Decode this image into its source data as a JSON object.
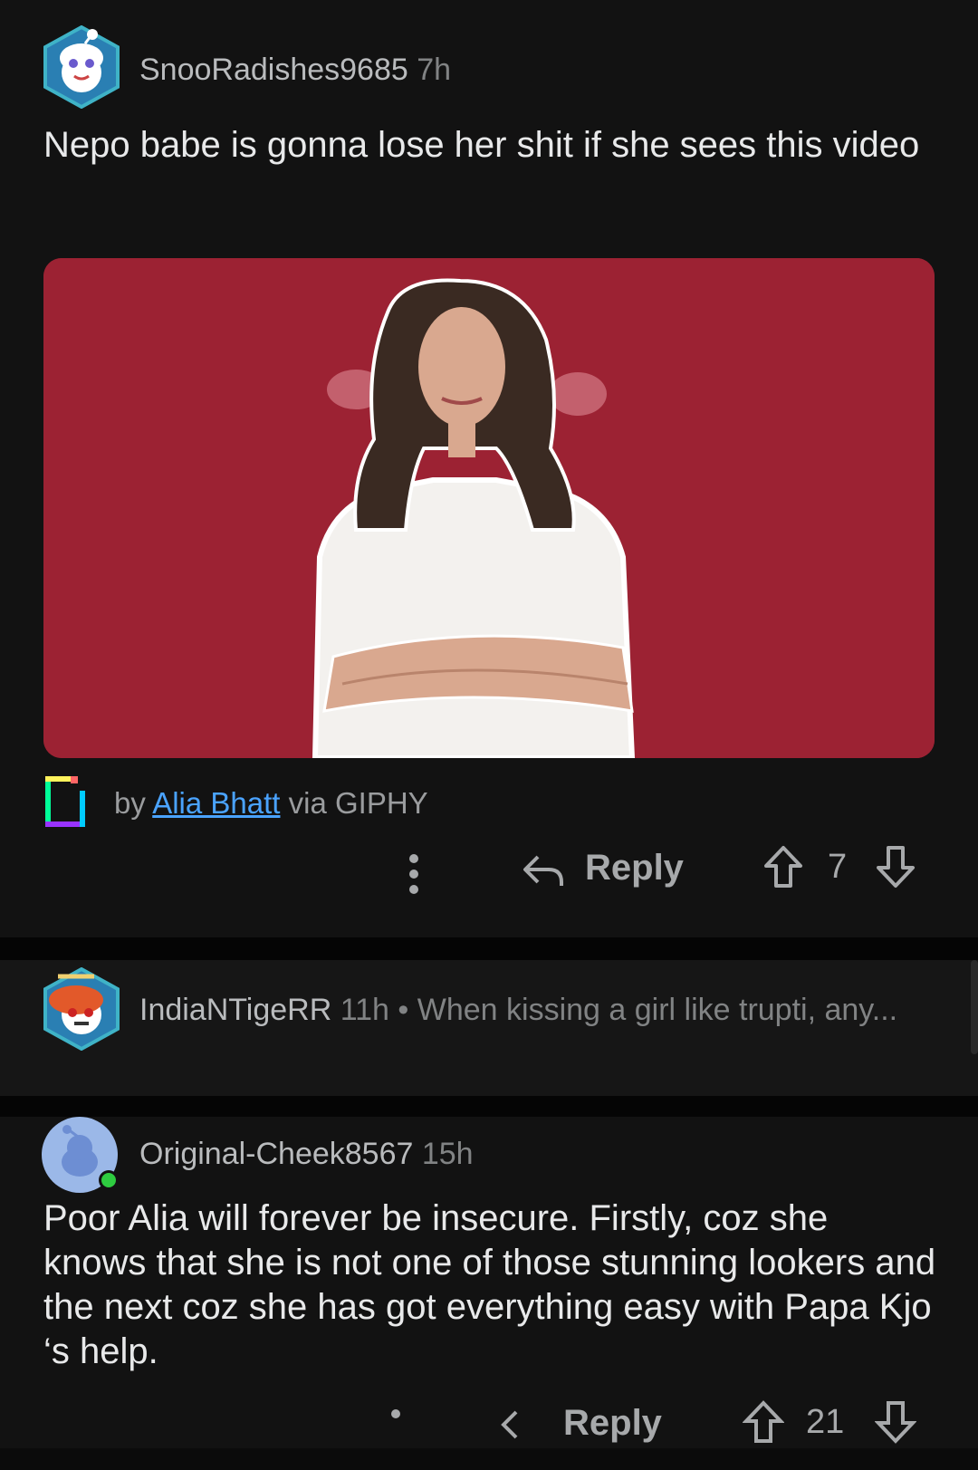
{
  "comments": [
    {
      "username": "SnooRadishes9685",
      "age": "7h",
      "text": "Nepo babe is gonna lose her shit if she sees this video",
      "giphy": {
        "by": "by",
        "author": "Alia Bhatt",
        "via": "via GIPHY"
      },
      "actions": {
        "reply_label": "Reply",
        "votes": "7"
      }
    },
    {
      "username": "IndiaNTigeRR",
      "age": "11h",
      "separator": "•",
      "preview": "When kissing a girl like trupti, any..."
    },
    {
      "username": "Original-Cheek8567",
      "age": "15h",
      "text": "Poor Alia will forever be insecure. Firstly, coz she knows that she is not one of those stunning lookers and the next coz she has got everything easy with Papa Kjo ‘s help.",
      "actions": {
        "reply_label": "Reply",
        "votes": "21"
      }
    }
  ],
  "colors": {
    "background": "#121212",
    "gif_background": "#9c2233",
    "link": "#4aa3ff",
    "online_dot": "#2ecc40"
  },
  "icons": [
    "more-vertical-icon",
    "reply-arrow-icon",
    "upvote-icon",
    "downvote-icon",
    "giphy-logo-icon"
  ]
}
